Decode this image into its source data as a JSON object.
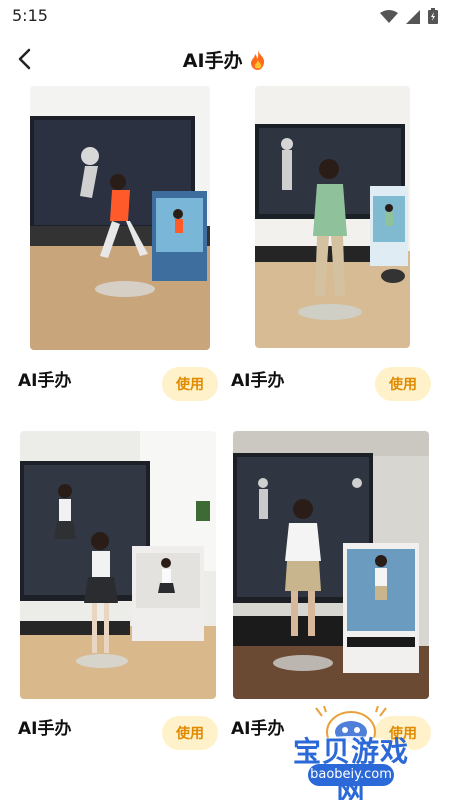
{
  "status_bar": {
    "time": "5:15",
    "icons": [
      "wifi-icon",
      "signal-icon",
      "battery-icon"
    ]
  },
  "header": {
    "title": "AI手办",
    "title_icon": "fire-icon"
  },
  "cards": [
    {
      "label": "AI手办",
      "button": "使用"
    },
    {
      "label": "AI手办",
      "button": "使用"
    },
    {
      "label": "AI手办",
      "button": "使用"
    },
    {
      "label": "AI手办",
      "button": "使用"
    }
  ],
  "watermark": {
    "title": "宝贝游戏网",
    "url": "baobeiy.com"
  },
  "colors": {
    "button_bg": "#fff1c9",
    "button_text": "#e08a00",
    "watermark_blue": "#2b68d8"
  }
}
